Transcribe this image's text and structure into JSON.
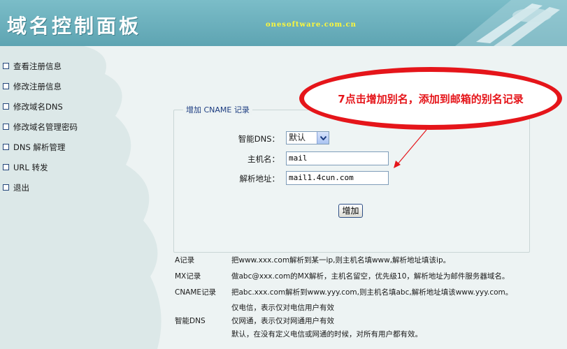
{
  "header": {
    "title": "域名控制面板",
    "domain": "onesoftware.com.cn"
  },
  "sidebar": {
    "items": [
      {
        "label": "查看注册信息"
      },
      {
        "label": "修改注册信息"
      },
      {
        "label": "修改域名DNS"
      },
      {
        "label": "修改域名管理密码"
      },
      {
        "label": "DNS 解析管理"
      },
      {
        "label": "URL 转发"
      },
      {
        "label": "退出"
      }
    ]
  },
  "form": {
    "legend": "增加 CNAME 记录",
    "dns_label": "智能DNS：",
    "dns_value": "默认",
    "host_label": "主机名：",
    "host_value": "mail",
    "addr_label": "解析地址：",
    "addr_value": "mail1.4cun.com",
    "add_button": "增加"
  },
  "callout": {
    "text": "7点击增加别名，添加到邮箱的别名记录",
    "color": "#e5151a"
  },
  "help": {
    "a_key": "A记录",
    "a_desc": "把www.xxx.com解析到某一ip,则主机名填www,解析地址填该ip。",
    "mx_key": "MX记录",
    "mx_desc": "做abc@xxx.com的MX解析，主机名留空，优先级10，解析地址为邮件服务器域名。",
    "cname_key": "CNAME记录",
    "cname_desc": "把abc.xxx.com解析到www.yyy.com,则主机名填abc,解析地址填该www.yyy.com。",
    "dns_key": "智能DNS",
    "dns_line1": "仅电信，表示仅对电信用户有效",
    "dns_line2": "仅网通，表示仅对网通用户有效",
    "dns_line3": "默认，在没有定义电信或网通的时候，对所有用户都有效。"
  }
}
